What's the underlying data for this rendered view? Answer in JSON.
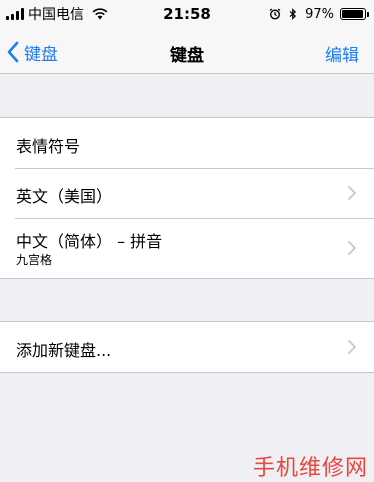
{
  "status_bar": {
    "carrier": "中国电信",
    "time": "21:58",
    "battery_percent": "97%",
    "battery_level": 0.97,
    "icons": [
      "signal-icon",
      "wifi-icon",
      "alarm-icon",
      "bluetooth-icon",
      "battery-icon"
    ]
  },
  "nav": {
    "back_label": "键盘",
    "title": "键盘",
    "right_label": "编辑"
  },
  "keyboards": {
    "items": [
      {
        "title": "表情符号",
        "subtitle": "",
        "has_chevron": false
      },
      {
        "title": "英文（美国）",
        "subtitle": "",
        "has_chevron": true
      },
      {
        "title": "中文（简体） – 拼音",
        "subtitle": "九宫格",
        "has_chevron": true
      }
    ]
  },
  "add_keyboard": {
    "label": "添加新键盘..."
  },
  "watermark": {
    "text": "手机维修网"
  },
  "colors": {
    "accent": "#1e7cf0",
    "background": "#efeff4",
    "separator": "#c8c7cc",
    "watermark": "#e9473c"
  }
}
